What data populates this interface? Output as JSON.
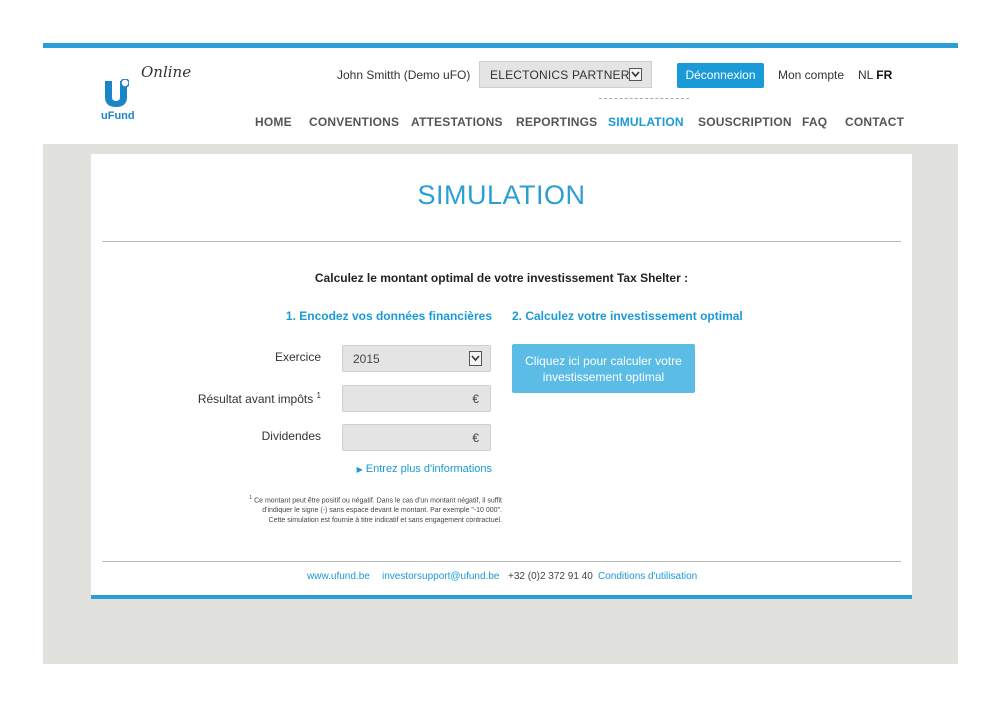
{
  "header": {
    "logo_online": "Online",
    "logo_brand": "uFund",
    "user_name": "John Smitth (Demo uFO)",
    "partner_select": "ELECTONICS PARTNER",
    "logout_label": "Déconnexion",
    "account_label": "Mon compte",
    "lang_nl": "NL",
    "lang_fr": "FR"
  },
  "nav": {
    "items": [
      {
        "label": "HOME"
      },
      {
        "label": "CONVENTIONS"
      },
      {
        "label": "ATTESTATIONS"
      },
      {
        "label": "REPORTINGS"
      },
      {
        "label": "SIMULATION"
      },
      {
        "label": "SOUSCRIPTION"
      },
      {
        "label": "FAQ"
      },
      {
        "label": "CONTACT"
      }
    ],
    "active": "SIMULATION"
  },
  "page": {
    "title": "SIMULATION",
    "headline": "Calculez le montant optimal de votre investissement Tax Shelter :",
    "step1": "1. Encodez vos données financières",
    "step2": "2. Calculez votre investissement optimal"
  },
  "form": {
    "exercice_label": "Exercice",
    "exercice_value": "2015",
    "resultat_label": "Résultat avant impôts",
    "resultat_sup": "1",
    "resultat_currency": "€",
    "dividendes_label": "Dividendes",
    "dividendes_currency": "€",
    "more_info": "Entrez plus d'informations",
    "calc_button": "Cliquez ici pour calculer votre investissement optimal"
  },
  "note": {
    "sup": "1",
    "line1": "Ce montant peut être positif ou négatif. Dans le cas d'un montant négatif, il suffit",
    "line2": "d'indiquer le signe (-) sans espace devant le montant. Par exemple \"-10 000\".",
    "line3": "Cette simulation est fournie à titre indicatif et sans engagement contractuel."
  },
  "footer": {
    "website": "www.ufund.be",
    "email": "investorsupport@ufund.be",
    "phone": "+32 (0)2 372 91 40",
    "terms": "Conditions d'utilisation"
  },
  "colors": {
    "accent": "#2a9fd6",
    "button": "#1a9ad6",
    "calc_button": "#5bbde6",
    "background_gray": "#e1e1de"
  }
}
